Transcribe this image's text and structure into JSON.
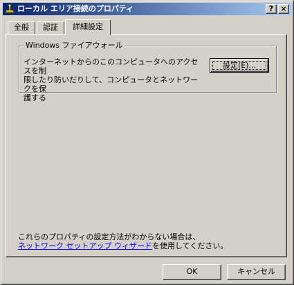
{
  "window": {
    "title": "ローカル エリア接続のプロパティ",
    "help_label": "?",
    "close_label": "×"
  },
  "tabs": [
    {
      "label": "全般",
      "active": false
    },
    {
      "label": "認証",
      "active": false
    },
    {
      "label": "詳細設定",
      "active": true
    }
  ],
  "firewall": {
    "group_label": "Windows ファイアウォール",
    "description_line1": "インターネットからのこのコンピュータへのアクセスを制",
    "description_line2": "限したり防いだりして、コンピュータとネットワークを保",
    "description_line3": "護する",
    "settings_button": "設定(E)..."
  },
  "help": {
    "line1": "これらのプロパティの設定方法がわからない場合は、",
    "link_text": "ネットワーク セットアップ ウィザード",
    "line2_suffix": "を使用してください。"
  },
  "buttons": {
    "ok": "OK",
    "cancel": "キャンセル"
  },
  "colors": {
    "titlebar_start": "#0a246a",
    "titlebar_end": "#a6caf0",
    "face": "#d4d0c8",
    "link": "#0000ff"
  },
  "icons": {
    "app": "network-connection-icon"
  }
}
